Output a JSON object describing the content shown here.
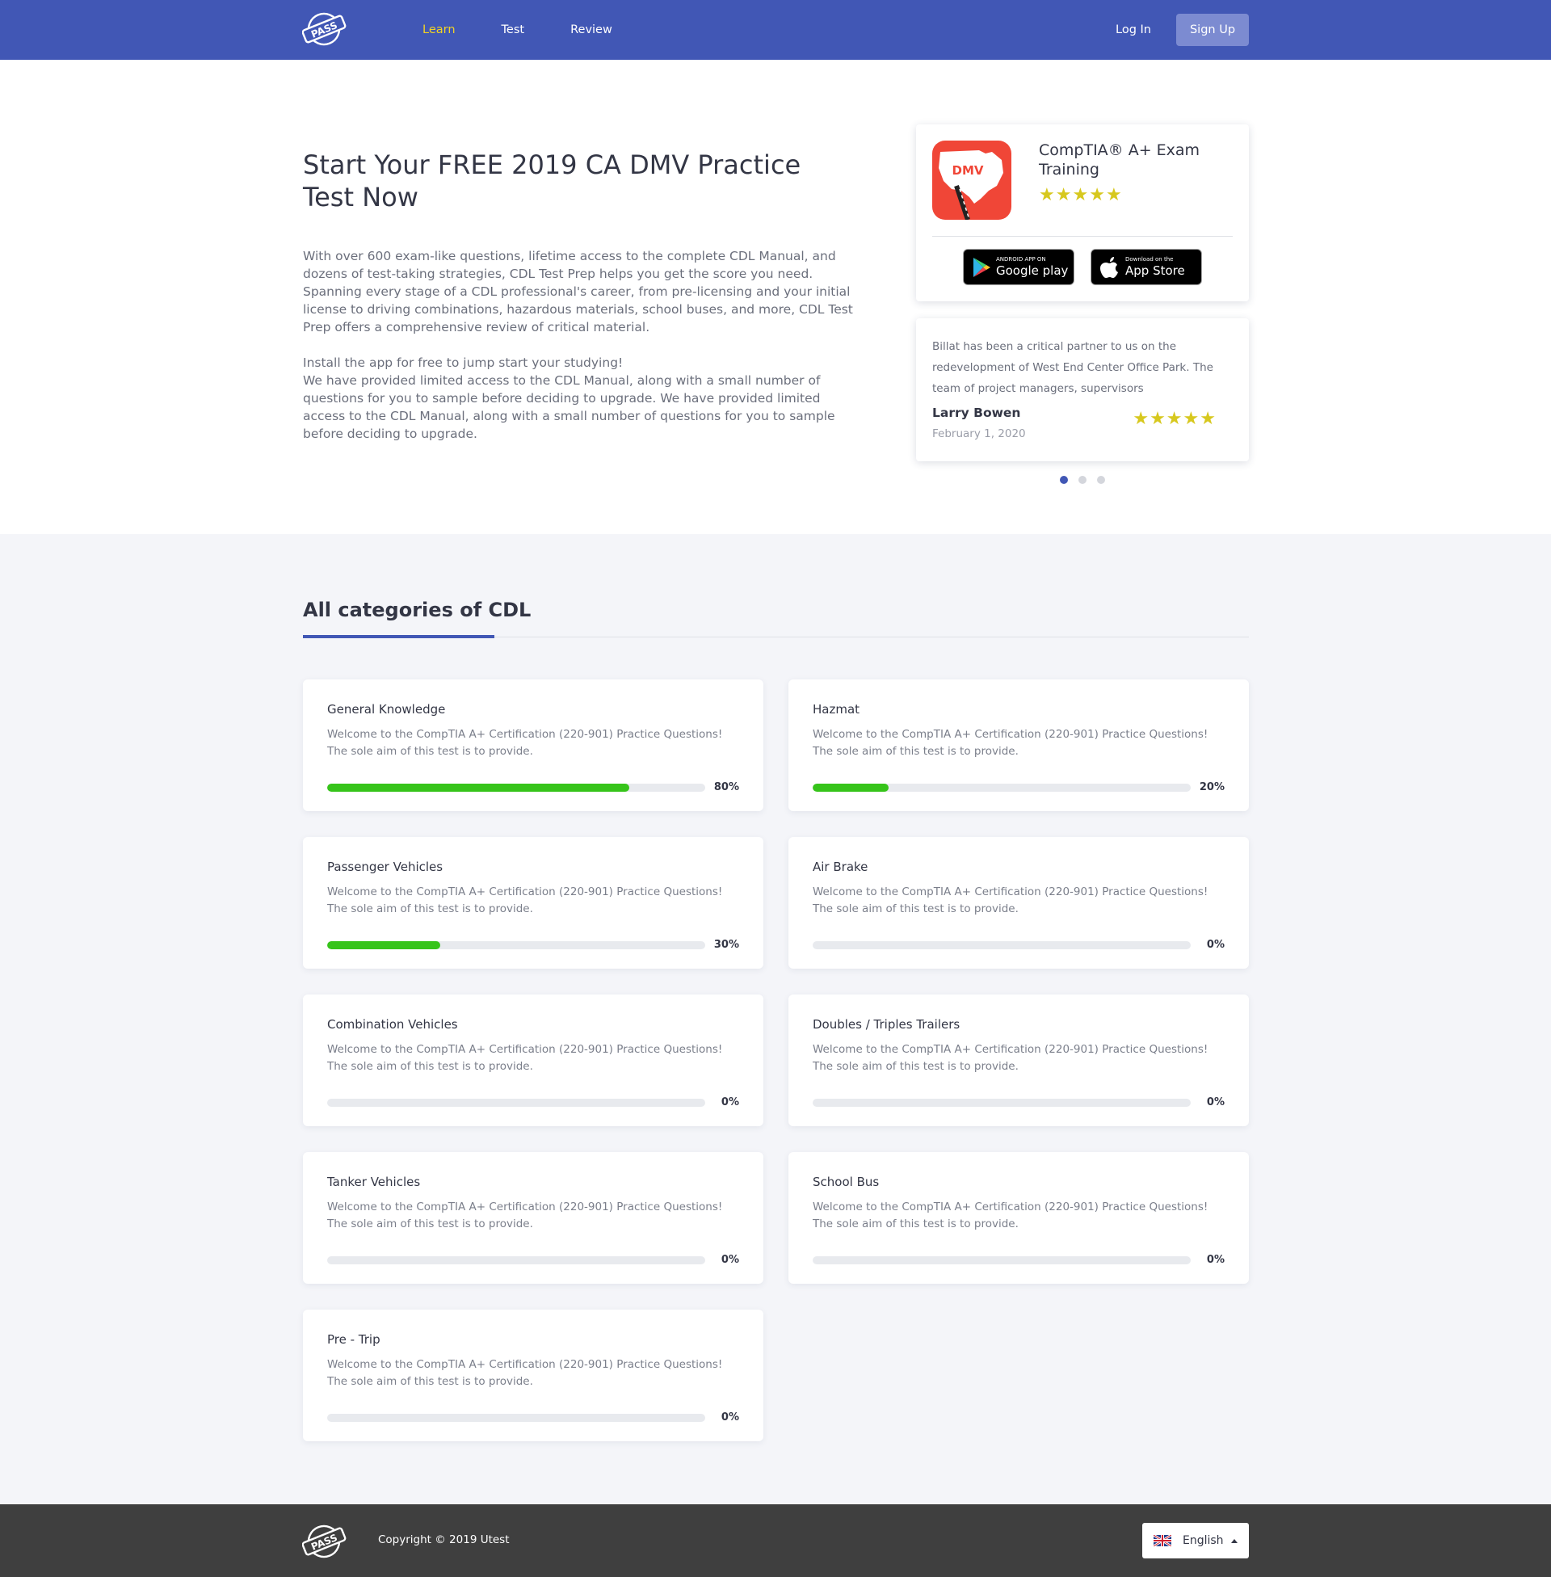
{
  "nav": {
    "logo_text": "PASS",
    "links": [
      {
        "label": "Learn",
        "active": true
      },
      {
        "label": "Test",
        "active": false
      },
      {
        "label": "Review",
        "active": false
      }
    ],
    "login_label": "Log In",
    "signup_label": "Sign Up"
  },
  "hero": {
    "title": "Start Your FREE 2019 CA DMV Practice Test Now",
    "paragraph1": "With over 600 exam-like questions, lifetime access to the complete CDL Manual, and dozens of test-taking strategies, CDL Test Prep helps you get the score you need. Spanning every stage of a CDL professional's career, from pre-licensing and your initial license to driving combinations, hazardous materials, school buses, and more, CDL Test Prep offers a comprehensive review of critical material.",
    "paragraph2_line1": "Install the app for free to jump start your studying!",
    "paragraph2_rest": "We have provided limited access to the CDL Manual, along with a small number of questions for you to sample before deciding to upgrade. We have provided limited access to the CDL Manual, along with a small number of questions for you to sample before deciding to upgrade."
  },
  "app_card": {
    "icon_label": "DMV",
    "title": "CompTIA® A+ Exam Training",
    "rating": 5,
    "google_play": {
      "small": "ANDROID APP ON",
      "big": "Google play"
    },
    "app_store": {
      "small": "Download on the",
      "big": "App Store"
    }
  },
  "review": {
    "text": "Billat has been a critical partner to us on the redevelopment of West End Center Office Park. The team of project managers, supervisors",
    "author": "Larry Bowen",
    "date": "February 1, 2020",
    "rating": 5,
    "slides": 3,
    "active_slide": 0
  },
  "categories": {
    "title": "All categories of CDL",
    "items": [
      {
        "title": "General Knowledge",
        "desc": "Welcome to the CompTIA A+ Certification (220-901)  Practice Questions! The sole aim of this test is to provide.",
        "progress": 80,
        "progress_label": "80%"
      },
      {
        "title": "Hazmat",
        "desc": "Welcome to the CompTIA A+ Certification (220-901)  Practice Questions! The sole aim of this test is to provide.",
        "progress": 20,
        "progress_label": "20%"
      },
      {
        "title": "Passenger Vehicles",
        "desc": "Welcome to the CompTIA A+ Certification (220-901)  Practice Questions! The sole aim of this test is to provide.",
        "progress": 30,
        "progress_label": "30%"
      },
      {
        "title": "Air Brake",
        "desc": "Welcome to the CompTIA A+ Certification (220-901)  Practice Questions! The sole aim of this test is to provide.",
        "progress": 0,
        "progress_label": "0%"
      },
      {
        "title": "Combination Vehicles",
        "desc": "Welcome to the CompTIA A+ Certification (220-901)  Practice Questions! The sole aim of this test is to provide.",
        "progress": 0,
        "progress_label": "0%"
      },
      {
        "title": "Doubles / Triples Trailers",
        "desc": "Welcome to the CompTIA A+ Certification (220-901)  Practice Questions! The sole aim of this test is to provide.",
        "progress": 0,
        "progress_label": "0%"
      },
      {
        "title": "Tanker Vehicles",
        "desc": "Welcome to the CompTIA A+ Certification (220-901)  Practice Questions! The sole aim of this test is to provide.",
        "progress": 0,
        "progress_label": "0%"
      },
      {
        "title": "School Bus",
        "desc": "Welcome to the CompTIA A+ Certification (220-901)  Practice Questions! The sole aim of this test is to provide.",
        "progress": 0,
        "progress_label": "0%"
      },
      {
        "title": "Pre - Trip",
        "desc": "Welcome to the CompTIA A+ Certification (220-901)  Practice Questions! The sole aim of this test is to provide.",
        "progress": 0,
        "progress_label": "0%"
      }
    ]
  },
  "footer": {
    "copyright": "Copyright © 2019 Utest",
    "language": "English"
  },
  "colors": {
    "nav_bg": "#4157b5",
    "nav_active": "#f1d324",
    "progress_fill": "#36c41a",
    "star": "#d7c81e",
    "footer_bg": "#3f3f3f"
  }
}
